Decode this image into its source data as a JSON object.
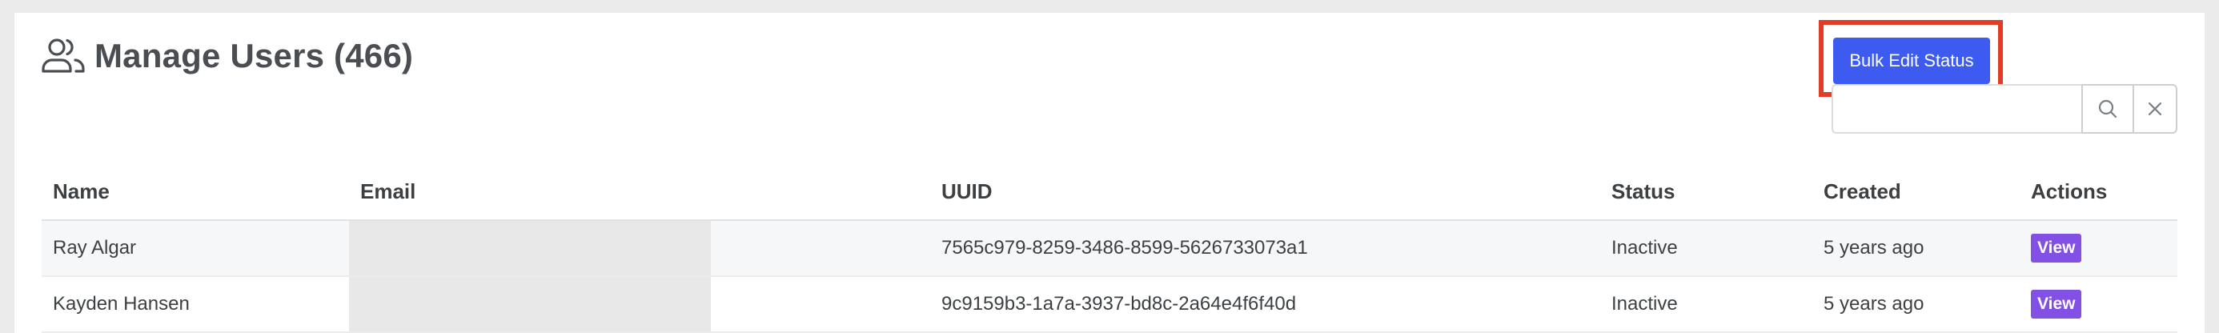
{
  "header": {
    "icon": "users-icon",
    "title": "Manage Users (466)"
  },
  "toolbar": {
    "bulk_edit_label": "Bulk Edit Status",
    "bulk_edit_color": "#3d5bf0",
    "highlight_color": "#e03d26",
    "search": {
      "value": "",
      "placeholder": ""
    },
    "search_icon": "search-icon",
    "clear_icon": "close-icon"
  },
  "table": {
    "columns": [
      "Name",
      "Email",
      "UUID",
      "Status",
      "Created",
      "Actions"
    ],
    "rows": [
      {
        "name": "Ray Algar",
        "email": "",
        "uuid": "7565c979-8259-3486-8599-5626733073a1",
        "status": "Inactive",
        "created": "5 years ago",
        "action": "View"
      },
      {
        "name": "Kayden Hansen",
        "email": "",
        "uuid": "9c9159b3-1a7a-3937-bd8c-2a64e4f6f40d",
        "status": "Inactive",
        "created": "5 years ago",
        "action": "View"
      }
    ],
    "action_color": "#8350e6"
  }
}
